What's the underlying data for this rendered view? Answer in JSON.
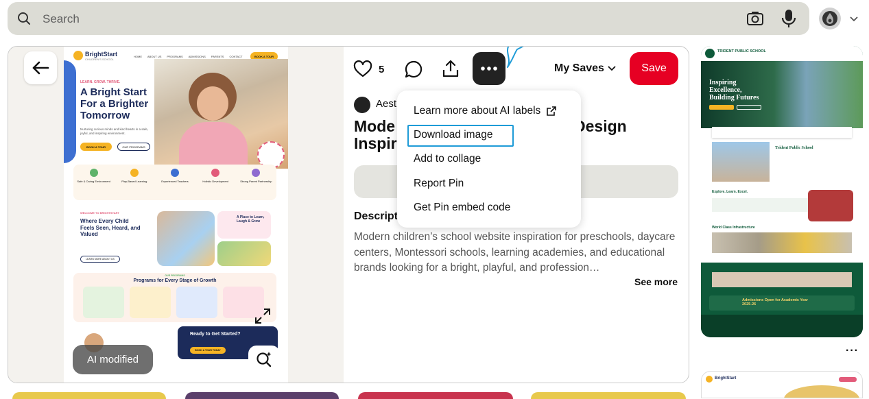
{
  "search": {
    "placeholder": "Search"
  },
  "pin": {
    "ai_badge": "AI modified",
    "like_count": "5",
    "my_saves": "My Saves",
    "save_label": "Save",
    "author": "Aest",
    "title_left": "Mode\nInspir",
    "title_right": "Design",
    "description_heading": "Descript",
    "description": "Modern children’s school website inspiration for preschools, daycare centers, Montessori schools, learning academies, and educational brands looking for a bright, playful, and profession…",
    "see_more": "See more"
  },
  "menu": {
    "items": [
      "Learn more about AI labels",
      "Download image",
      "Add to collage",
      "Report Pin",
      "Get Pin embed code"
    ]
  },
  "pin_image": {
    "brand": "BrightStart",
    "brand_sub": "CHILDREN'S SCHOOL",
    "nav": [
      "HOME",
      "ABOUT US",
      "PROGRAMS",
      "ADMISSIONS",
      "PARENTS",
      "CONTACT"
    ],
    "cta_tour": "BOOK A TOUR",
    "tagline": "LEARN. GROW. THRIVE.",
    "hero_title": "A Bright Start For a Brighter Tomorrow",
    "hero_sub": "Nurturing curious minds and kind hearts in a safe, joyful, and inspiring environment.",
    "btn_tour": "BOOK A TOUR",
    "btn_programs": "OUR PROGRAMS",
    "features": [
      "Safe & Caring Environment",
      "Play-Based Learning",
      "Experienced Teachers",
      "Holistic Development",
      "Strong Parent Partnership"
    ],
    "welcome": "WELCOME TO BRIGHTSTART",
    "where_title": "Where Every Child Feels Seen, Heard, and Valued",
    "learn_more": "LEARN MORE ABOUT US",
    "place_title": "A Place to Learn, Laugh & Grow",
    "programs_kicker": "OUR PROGRAMS",
    "programs_title": "Programs for Every Stage of Growth",
    "ready_title": "Ready to Get Started?",
    "ready_btn": "BOOK A TOUR TODAY"
  },
  "thumb1": {
    "school": "TRIDENT PUBLIC SCHOOL",
    "hero": "Inspiring Excellence, Building Futures",
    "section": "Trident Public School",
    "explore": "Explore. Learn. Excel.",
    "world": "World Class Infrastructure",
    "admissions": "Admissions Open for Academic Year 2025-26"
  },
  "thumb2": {
    "brand": "BrightStart"
  },
  "thumb_more": "···",
  "colors": {
    "save": "#e60023",
    "annotation": "#1e9bd7",
    "search_bg": "#dcdcd5"
  }
}
